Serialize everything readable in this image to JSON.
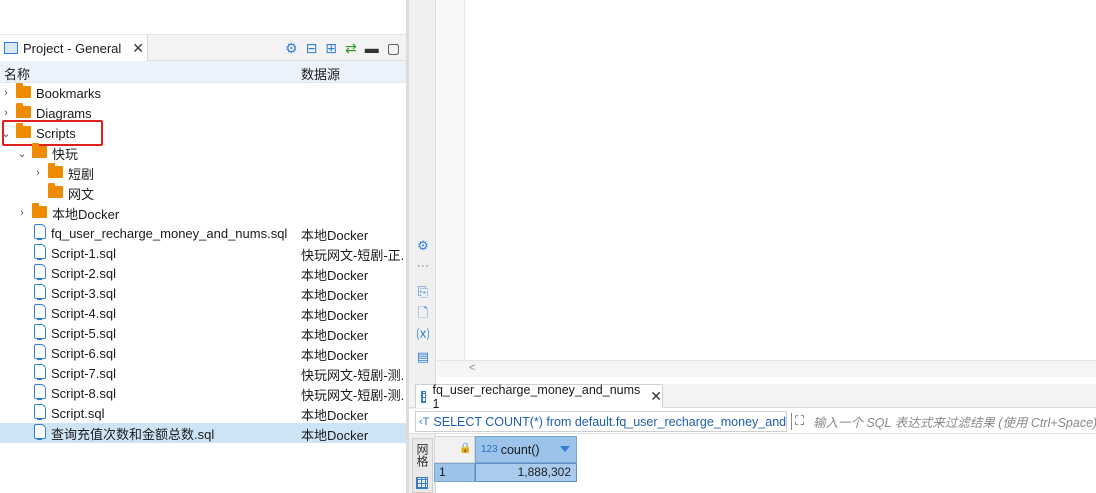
{
  "project_panel": {
    "tab_label": "Project - General",
    "columns": {
      "name": "名称",
      "datasource": "数据源"
    }
  },
  "tree": {
    "bookmarks": "Bookmarks",
    "diagrams": "Diagrams",
    "scripts": "Scripts",
    "folders": {
      "kuaiwan": "快玩",
      "duanju": "短剧",
      "wangwen": "网文",
      "bendi_docker": "本地Docker"
    },
    "scripts_list": [
      {
        "name": "fq_user_recharge_money_and_nums.sql",
        "datasource": "本地Docker"
      },
      {
        "name": "Script-1.sql",
        "datasource": "快玩网文-短剧-正..."
      },
      {
        "name": "Script-2.sql",
        "datasource": "本地Docker"
      },
      {
        "name": "Script-3.sql",
        "datasource": "本地Docker"
      },
      {
        "name": "Script-4.sql",
        "datasource": "本地Docker"
      },
      {
        "name": "Script-5.sql",
        "datasource": "本地Docker"
      },
      {
        "name": "Script-6.sql",
        "datasource": "本地Docker"
      },
      {
        "name": "Script-7.sql",
        "datasource": "快玩网文-短剧-测..."
      },
      {
        "name": "Script-8.sql",
        "datasource": "快玩网文-短剧-测..."
      },
      {
        "name": "Script.sql",
        "datasource": "本地Docker"
      },
      {
        "name": "查询充值次数和金额总数.sql",
        "datasource": "本地Docker"
      }
    ]
  },
  "results": {
    "tab_label": "fq_user_recharge_money_and_nums 1",
    "query_text": "SELECT COUNT(*) from default.fq_user_recharge_money_and",
    "filter_placeholder": "输入一个 SQL 表达式来过滤结果 (使用 Ctrl+Space)",
    "side_label": "网格",
    "column": {
      "type_badge": "123",
      "name": "count()"
    },
    "rows": [
      {
        "num": "1",
        "value": "1,888,302"
      }
    ]
  },
  "colors": {
    "accent": "#2f7fd8",
    "folder": "#f08a00",
    "selection": "#cde4f7",
    "highlight_box": "#e02020",
    "grid_selected": "#9cc3ea"
  },
  "icons": [
    "project-icon",
    "gear-icon",
    "collapse-icon",
    "expand-icon",
    "link-icon",
    "minimize-icon",
    "maximize-icon",
    "folder-icon",
    "script-icon",
    "grid-icon",
    "lock-icon"
  ]
}
